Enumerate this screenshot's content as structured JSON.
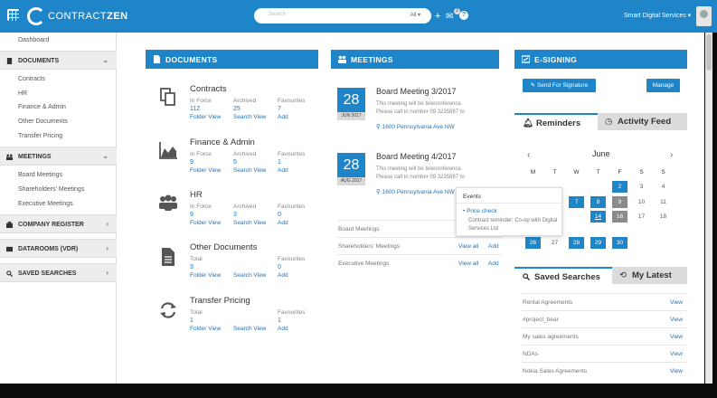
{
  "app": {
    "logo_prefix": "CONTRACT",
    "logo_suffix": "ZEN",
    "search_placeholder": "Search",
    "search_scope": "All",
    "notification_count": "2",
    "company": "Smart Digital Services"
  },
  "sidebar": {
    "dashboard": "Dashboard",
    "documents": "DOCUMENTS",
    "doc_links": [
      "Contracts",
      "HR",
      "Finance & Admin",
      "Other Documents",
      "Transfer Pricing"
    ],
    "meetings": "MEETINGS",
    "meeting_links": [
      "Board Meetings",
      "Shareholders' Meetings",
      "Executive Meetings"
    ],
    "company_register": "COMPANY REGISTER",
    "datarooms": "DATAROOMS (VDR)",
    "saved_searches": "SAVED SEARCHES"
  },
  "documents": {
    "title": "DOCUMENTS",
    "items": [
      {
        "name": "Contracts",
        "c1_label": "In Force",
        "c1_value": "112",
        "c1_link": "Folder View",
        "c2_label": "Archived",
        "c2_value": "25",
        "c2_link": "Search View",
        "c3_label": "Favourites",
        "c3_value": "7",
        "c3_link": "Add"
      },
      {
        "name": "Finance & Admin",
        "c1_label": "In Force",
        "c1_value": "9",
        "c1_link": "Folder View",
        "c2_label": "Archived",
        "c2_value": "5",
        "c2_link": "Search View",
        "c3_label": "Favourites",
        "c3_value": "1",
        "c3_link": "Add"
      },
      {
        "name": "HR",
        "c1_label": "In Force",
        "c1_value": "9",
        "c1_link": "Folder View",
        "c2_label": "Archived",
        "c2_value": "3",
        "c2_link": "Search View",
        "c3_label": "Favourites",
        "c3_value": "0",
        "c3_link": "Add"
      },
      {
        "name": "Other Documents",
        "c1_label": "Total",
        "c1_value": "3",
        "c1_link": "Folder View",
        "c2_label": "",
        "c2_value": "",
        "c2_link": "Search View",
        "c3_label": "Favourites",
        "c3_value": "0",
        "c3_link": "Add"
      },
      {
        "name": "Transfer Pricing",
        "c1_label": "Total",
        "c1_value": "1",
        "c1_link": "Folder View",
        "c2_label": "",
        "c2_value": "",
        "c2_link": "Search View",
        "c3_label": "Favourites",
        "c3_value": "1",
        "c3_link": "Add"
      }
    ]
  },
  "meetings": {
    "title": "MEETINGS",
    "items": [
      {
        "day": "28",
        "month": "JUN 2017",
        "title": "Board Meeting 3/2017",
        "line1": "This meeting will be teleconference.",
        "line2": "Please call to number 09 3235887 to",
        "location": "1600 Pennsylvania Ave NW"
      },
      {
        "day": "28",
        "month": "AUG 2017",
        "title": "Board Meeting 4/2017",
        "line1": "This meeting will be teleconference.",
        "line2": "Please call to number 09 3235887 to",
        "location": "1600 Pennsylvania Ave NW"
      }
    ],
    "rows": [
      {
        "name": "Board Meetings",
        "view": "",
        "add": ""
      },
      {
        "name": "Shareholders' Meetings",
        "view": "View all",
        "add": "Add"
      },
      {
        "name": "Executive Meetings",
        "view": "View all",
        "add": "Add"
      }
    ],
    "popup": {
      "heading": "Events",
      "item": "Price check",
      "text": "Contract reminder: Co-op with Digital Services Ltd"
    }
  },
  "esigning": {
    "title": "E-SIGNING",
    "send_button": "Send For Signature",
    "manage_button": "Manage"
  },
  "reminders": {
    "tab_reminders": "Reminders",
    "tab_activity": "Activity Feed",
    "month": "June",
    "weekdays": [
      "M",
      "T",
      "W",
      "T",
      "F",
      "S",
      "S"
    ],
    "weeks": [
      [
        "",
        "",
        "",
        "",
        "2",
        "3",
        "4"
      ],
      [
        "",
        "",
        "7",
        "8",
        "9",
        "10",
        "11"
      ],
      [
        "",
        "",
        "",
        "14",
        "16",
        "17",
        "18"
      ],
      [
        "",
        "",
        "",
        "",
        "",
        "",
        ""
      ],
      [
        "26",
        "27",
        "28",
        "29",
        "30",
        "",
        ""
      ]
    ]
  },
  "saved_searches": {
    "tab_saved": "Saved Searches",
    "tab_latest": "My Latest",
    "items": [
      {
        "name": "Rental Agreements",
        "link": "View"
      },
      {
        "name": "#project_bear",
        "link": "View"
      },
      {
        "name": "My sales agreements",
        "link": "View"
      },
      {
        "name": "NDAs",
        "link": "View"
      },
      {
        "name": "Nokia Sales Agreements",
        "link": "View"
      }
    ]
  },
  "colors": {
    "brand_blue": "#1e85c9",
    "link_blue": "#1e73b8",
    "highlight_gray": "#8a8a8a"
  }
}
